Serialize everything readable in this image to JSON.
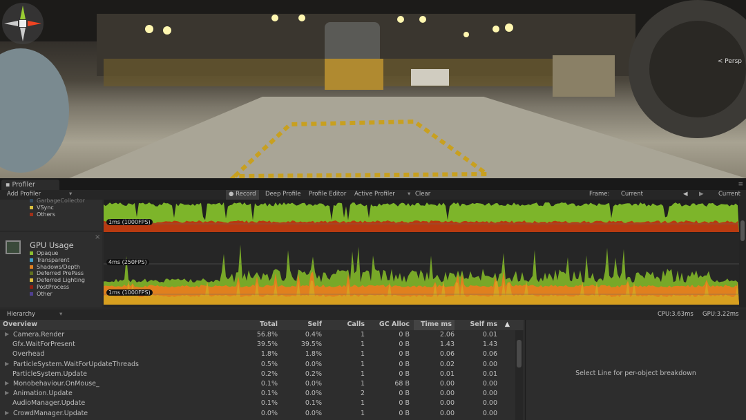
{
  "scene": {
    "gizmo_label": "< Persp"
  },
  "window": {
    "tab": "Profiler"
  },
  "toolbar": {
    "add_profiler": "Add Profiler",
    "record": "Record",
    "deep_profile": "Deep Profile",
    "profile_editor": "Profile Editor",
    "active_profiler": "Active Profiler",
    "clear": "Clear",
    "frame_label": "Frame:",
    "frame_value": "Current",
    "current": "Current"
  },
  "cpu": {
    "legend_partial": "GarbageCollector",
    "legend": [
      {
        "label": "VSync",
        "color": "#d8c040"
      },
      {
        "label": "Others",
        "color": "#a03018"
      }
    ],
    "label_1ms": "1ms (1000FPS)"
  },
  "gpu": {
    "title": "GPU Usage",
    "legend": [
      {
        "label": "Opaque",
        "color": "#8cc030"
      },
      {
        "label": "Transparent",
        "color": "#40a0c8"
      },
      {
        "label": "Shadows/Depth",
        "color": "#e08020"
      },
      {
        "label": "Deferred PrePass",
        "color": "#607020"
      },
      {
        "label": "Deferred Lighting",
        "color": "#e0c040"
      },
      {
        "label": "PostProcess",
        "color": "#902010"
      },
      {
        "label": "Other",
        "color": "#504090"
      }
    ],
    "label_4ms": "4ms (250FPS)",
    "label_1ms": "1ms (1000FPS)"
  },
  "hierarchy": {
    "mode": "Hierarchy",
    "cpu_time": "CPU:3.63ms",
    "gpu_time": "GPU:3.22ms"
  },
  "table": {
    "columns": [
      "Overview",
      "Total",
      "Self",
      "Calls",
      "GC Alloc",
      "Time ms",
      "Self ms"
    ],
    "rows": [
      {
        "name": "Camera.Render",
        "expand": true,
        "total": "56.8%",
        "self": "0.4%",
        "calls": "1",
        "gc": "0 B",
        "time": "2.06",
        "selfms": "0.01"
      },
      {
        "name": "Gfx.WaitForPresent",
        "expand": false,
        "total": "39.5%",
        "self": "39.5%",
        "calls": "1",
        "gc": "0 B",
        "time": "1.43",
        "selfms": "1.43"
      },
      {
        "name": "Overhead",
        "expand": false,
        "total": "1.8%",
        "self": "1.8%",
        "calls": "1",
        "gc": "0 B",
        "time": "0.06",
        "selfms": "0.06"
      },
      {
        "name": "ParticleSystem.WaitForUpdateThreads",
        "expand": true,
        "total": "0.5%",
        "self": "0.0%",
        "calls": "1",
        "gc": "0 B",
        "time": "0.02",
        "selfms": "0.00"
      },
      {
        "name": "ParticleSystem.Update",
        "expand": false,
        "total": "0.2%",
        "self": "0.2%",
        "calls": "1",
        "gc": "0 B",
        "time": "0.01",
        "selfms": "0.01"
      },
      {
        "name": "Monobehaviour.OnMouse_",
        "expand": true,
        "total": "0.1%",
        "self": "0.0%",
        "calls": "1",
        "gc": "68 B",
        "time": "0.00",
        "selfms": "0.00"
      },
      {
        "name": "Animation.Update",
        "expand": true,
        "total": "0.1%",
        "self": "0.0%",
        "calls": "2",
        "gc": "0 B",
        "time": "0.00",
        "selfms": "0.00"
      },
      {
        "name": "AudioManager.Update",
        "expand": false,
        "total": "0.1%",
        "self": "0.1%",
        "calls": "1",
        "gc": "0 B",
        "time": "0.00",
        "selfms": "0.00"
      },
      {
        "name": "CrowdManager.Update",
        "expand": true,
        "total": "0.0%",
        "self": "0.0%",
        "calls": "1",
        "gc": "0 B",
        "time": "0.00",
        "selfms": "0.00"
      }
    ]
  },
  "detail": {
    "message": "Select Line for per-object breakdown"
  }
}
